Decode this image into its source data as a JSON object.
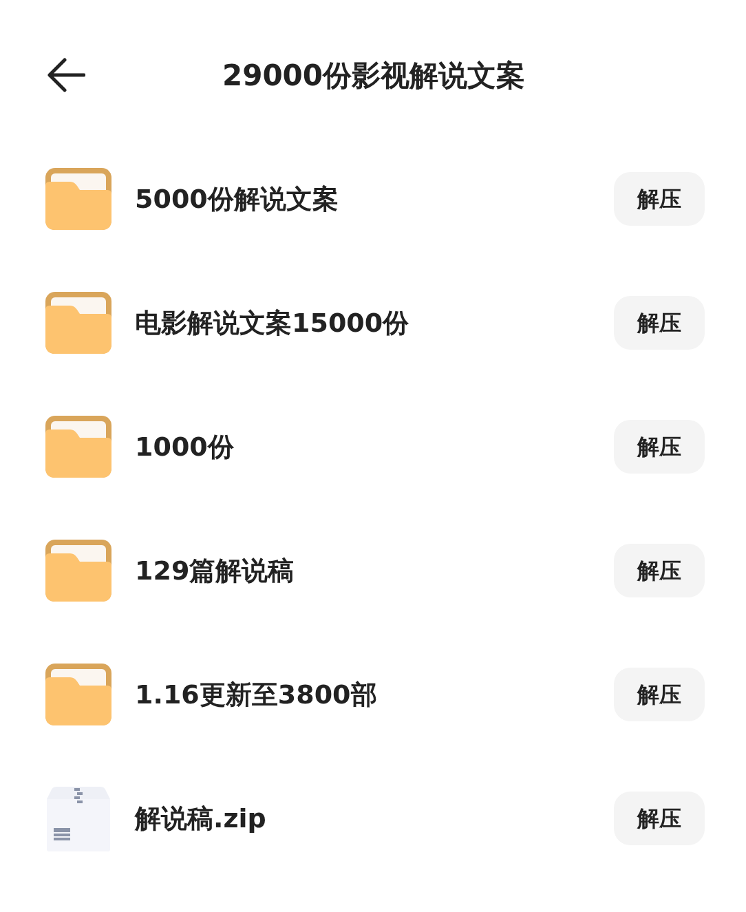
{
  "header": {
    "title": "29000份影视解说文案"
  },
  "items": [
    {
      "kind": "folder",
      "name": "5000份解说文案",
      "action": "解压"
    },
    {
      "kind": "folder",
      "name": "电影解说文案15000份",
      "action": "解压"
    },
    {
      "kind": "folder",
      "name": "1000份",
      "action": "解压"
    },
    {
      "kind": "folder",
      "name": "129篇解说稿",
      "action": "解压"
    },
    {
      "kind": "folder",
      "name": "1.16更新至3800部",
      "action": "解压"
    },
    {
      "kind": "archive",
      "name": "解说稿.zip",
      "action": "解压"
    }
  ]
}
